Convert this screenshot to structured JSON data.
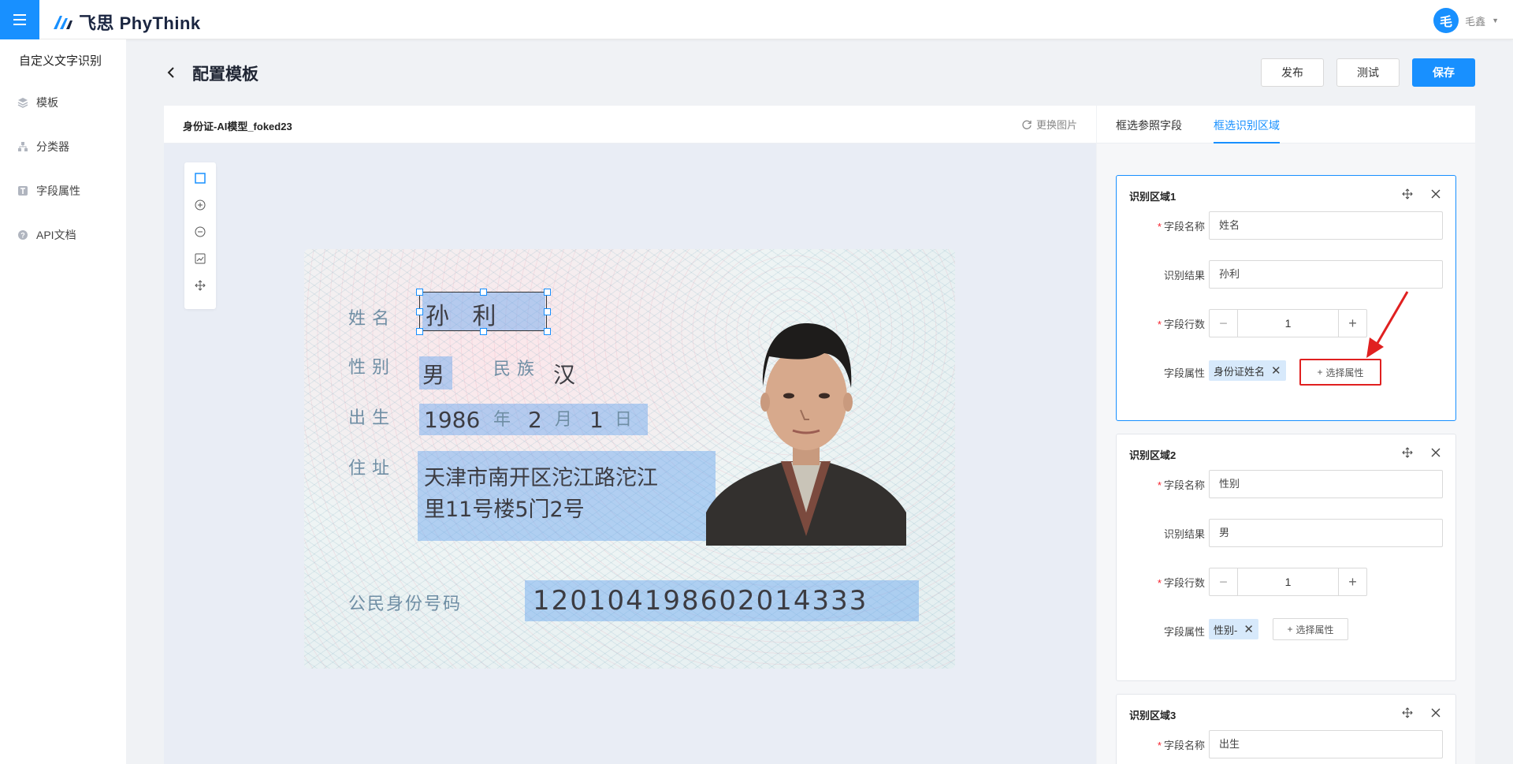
{
  "app": {
    "brand": "飞思 PhyThink",
    "user_avatar": "毛",
    "user_name": "毛鑫"
  },
  "sidebar": {
    "title": "自定义文字识别",
    "items": [
      {
        "label": "模板",
        "icon": "layers-icon"
      },
      {
        "label": "分类器",
        "icon": "hierarchy-icon"
      },
      {
        "label": "字段属性",
        "icon": "field-icon"
      },
      {
        "label": "API文档",
        "icon": "help-icon"
      }
    ]
  },
  "header": {
    "title": "配置模板",
    "publish_label": "发布",
    "test_label": "测试",
    "save_label": "保存"
  },
  "image_panel": {
    "template_name": "身份证-AI模型_foked23",
    "replace_label": "更换图片"
  },
  "idcard": {
    "name_label": "姓名",
    "name_value": "孙 利",
    "gender_label": "性别",
    "gender_value": "男",
    "ethnicity_label": "民族",
    "ethnicity_value": "汉",
    "birth_label": "出生",
    "birth_year": "1986",
    "year_unit": "年",
    "birth_month": "2",
    "month_unit": "月",
    "birth_day": "1",
    "day_unit": "日",
    "address_label": "住址",
    "address_line1": "天津市南开区沱江路沱江",
    "address_line2": "里11号楼5门2号",
    "idnum_label": "公民身份号码",
    "idnum_value": "120104198602014333"
  },
  "right_panel": {
    "tabs": [
      "框选参照字段",
      "框选识别区域"
    ],
    "active_tab": 1,
    "labels": {
      "field_name": "字段名称",
      "result": "识别结果",
      "lines": "字段行数",
      "attr": "字段属性",
      "add_attr": "选择属性"
    },
    "regions": [
      {
        "title": "识别区域1",
        "field_name": "姓名",
        "result": "孙利",
        "lines": "1",
        "attr_tag": "身份证姓名"
      },
      {
        "title": "识别区域2",
        "field_name": "性别",
        "result": "男",
        "lines": "1",
        "attr_tag": "性别-"
      },
      {
        "title": "识别区域3",
        "field_name": "出生"
      }
    ]
  },
  "colors": {
    "primary": "#1890ff",
    "annotation": "#e02020"
  }
}
